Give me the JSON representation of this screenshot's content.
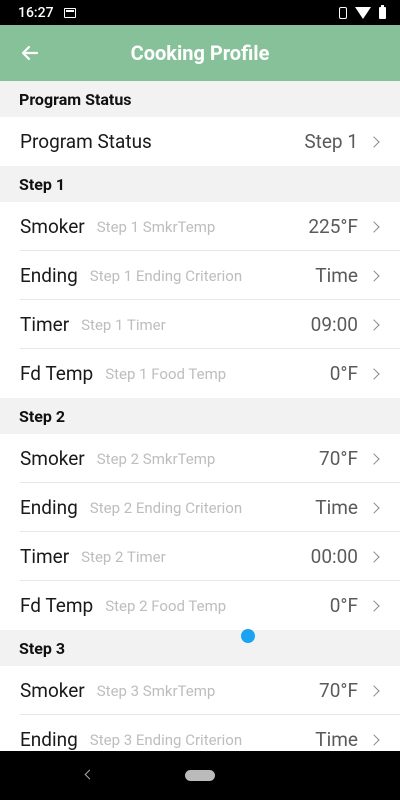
{
  "status_bar": {
    "time": "16:27"
  },
  "app_bar": {
    "title": "Cooking Profile"
  },
  "program_status": {
    "header": "Program Status",
    "row": {
      "label": "Program Status",
      "value": "Step 1"
    }
  },
  "steps": [
    {
      "header": "Step 1",
      "rows": [
        {
          "label": "Smoker",
          "sub": "Step 1 SmkrTemp",
          "value": "225°F"
        },
        {
          "label": "Ending",
          "sub": "Step 1 Ending Criterion",
          "value": "Time"
        },
        {
          "label": "Timer",
          "sub": "Step 1 Timer",
          "value": "09:00"
        },
        {
          "label": "Fd Temp",
          "sub": "Step 1 Food Temp",
          "value": "0°F"
        }
      ]
    },
    {
      "header": "Step 2",
      "rows": [
        {
          "label": "Smoker",
          "sub": "Step 2 SmkrTemp",
          "value": "70°F"
        },
        {
          "label": "Ending",
          "sub": "Step 2 Ending Criterion",
          "value": "Time"
        },
        {
          "label": "Timer",
          "sub": "Step 2 Timer",
          "value": "00:00"
        },
        {
          "label": "Fd Temp",
          "sub": "Step 2 Food Temp",
          "value": "0°F"
        }
      ]
    },
    {
      "header": "Step 3",
      "rows": [
        {
          "label": "Smoker",
          "sub": "Step 3 SmkrTemp",
          "value": "70°F"
        },
        {
          "label": "Ending",
          "sub": "Step 3 Ending Criterion",
          "value": "Time"
        }
      ]
    }
  ],
  "colors": {
    "app_bar": "#86c19a",
    "touch_dot": "#1aa3f0"
  }
}
